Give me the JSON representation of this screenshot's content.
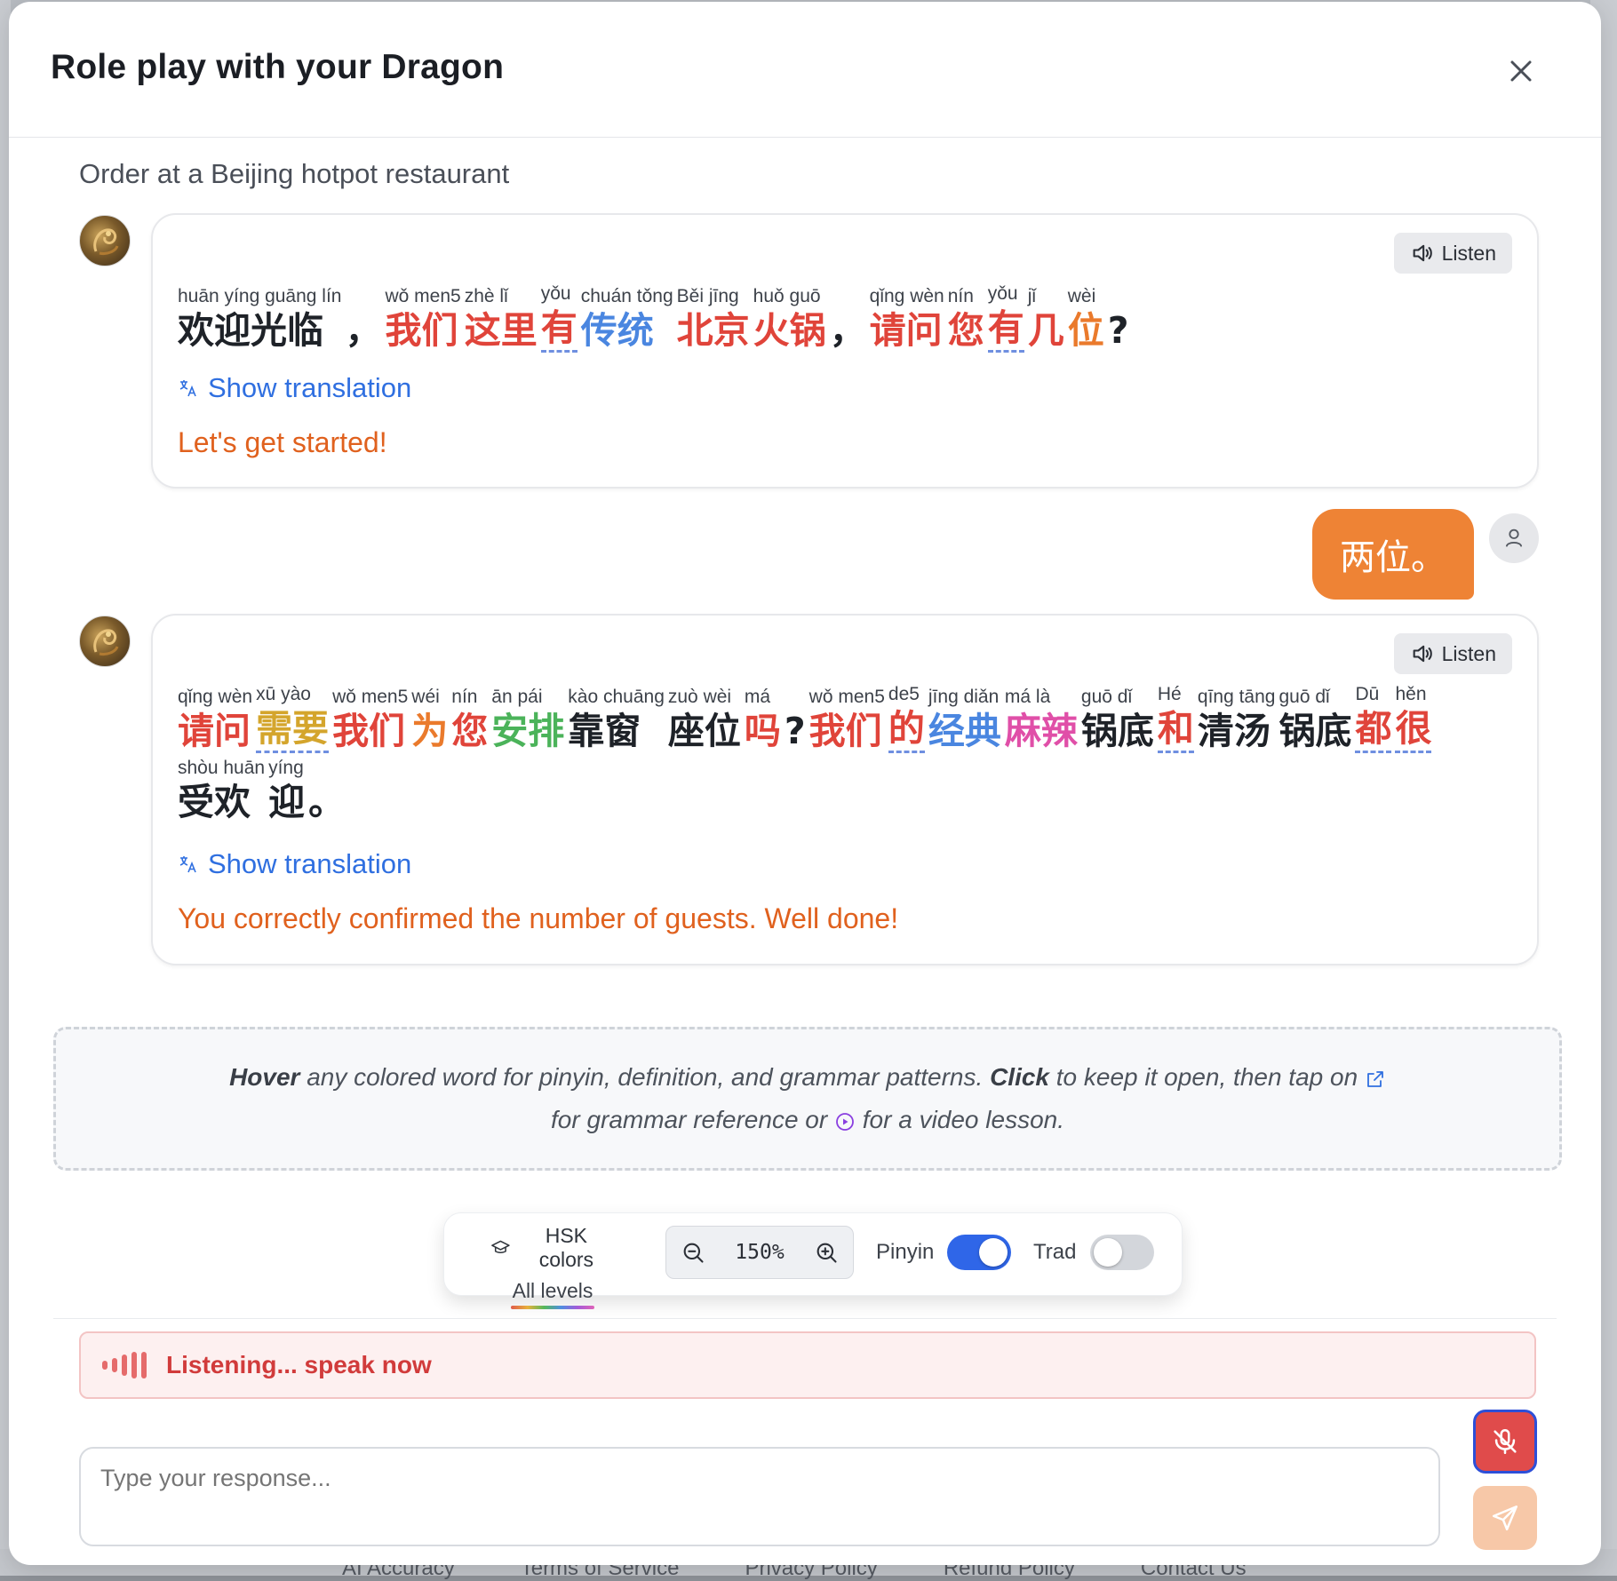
{
  "modal": {
    "title": "Role play with your Dragon",
    "scenario": "Order at a Beijing hotpot restaurant"
  },
  "messages": {
    "m1": {
      "listen_label": "Listen",
      "words": [
        {
          "py": "huān yíng guāng lín",
          "hz": "欢迎光临",
          "color": "#1e2228",
          "u": false
        },
        {
          "py": "",
          "hz": "，",
          "color": "#1e2228",
          "u": false
        },
        {
          "py": "wǒ men5",
          "hz": "我们",
          "color": "#e0443a",
          "u": false
        },
        {
          "py": "zhè lǐ",
          "hz": "这里",
          "color": "#e0443a",
          "u": false
        },
        {
          "py": "yǒu",
          "hz": "有",
          "color": "#e0443a",
          "u": true
        },
        {
          "py": "chuán tǒng",
          "hz": "传统",
          "color": "#4a86e0",
          "u": false
        },
        {
          "py": "Běi jīng",
          "hz": "北京",
          "color": "#e0443a",
          "u": false
        },
        {
          "py": "huǒ guō",
          "hz": "火锅",
          "color": "#e0443a",
          "u": false
        },
        {
          "py": "",
          "hz": "，",
          "color": "#1e2228",
          "u": false
        },
        {
          "py": "qǐng wèn",
          "hz": "请问",
          "color": "#e0443a",
          "u": false
        },
        {
          "py": "nín",
          "hz": "您",
          "color": "#e0443a",
          "u": false
        },
        {
          "py": "yǒu",
          "hz": "有",
          "color": "#e0443a",
          "u": true
        },
        {
          "py": "jǐ",
          "hz": "几",
          "color": "#e0443a",
          "u": false
        },
        {
          "py": "wèi",
          "hz": "位",
          "color": "#ea7a2c",
          "u": false
        },
        {
          "py": "",
          "hz": "?",
          "color": "#1e2228",
          "u": false
        }
      ],
      "show_translation": "Show translation",
      "feedback": "Let's get started!"
    },
    "user": {
      "text": "两位。"
    },
    "m2": {
      "listen_label": "Listen",
      "words": [
        {
          "py": "qǐng wèn",
          "hz": "请问",
          "color": "#e0443a",
          "u": false
        },
        {
          "py": "xū yào",
          "hz": "需要",
          "color": "#d4a52c",
          "u": true
        },
        {
          "py": "wǒ men5",
          "hz": "我们",
          "color": "#e0443a",
          "u": false
        },
        {
          "py": "wéi",
          "hz": "为",
          "color": "#ea7a2c",
          "u": false
        },
        {
          "py": "nín",
          "hz": "您",
          "color": "#e0443a",
          "u": false
        },
        {
          "py": "ān pái",
          "hz": "安排",
          "color": "#4bb35a",
          "u": false
        },
        {
          "py": "kào chuāng",
          "hz": "靠窗",
          "color": "#1e2228",
          "u": false
        },
        {
          "py": "zuò wèi",
          "hz": "座位",
          "color": "#1e2228",
          "u": false
        },
        {
          "py": "má",
          "hz": "吗",
          "color": "#e0443a",
          "u": false
        },
        {
          "py": "",
          "hz": "?",
          "color": "#1e2228",
          "u": false
        },
        {
          "py": "wǒ men5",
          "hz": "我们",
          "color": "#e0443a",
          "u": false
        },
        {
          "py": "de5",
          "hz": "的",
          "color": "#e0443a",
          "u": true
        },
        {
          "py": "jīng diǎn",
          "hz": "经典",
          "color": "#4a86e0",
          "u": false
        },
        {
          "py": "má là",
          "hz": "麻辣",
          "color": "#e04fa8",
          "u": false
        },
        {
          "py": "guō dǐ",
          "hz": "锅底",
          "color": "#1e2228",
          "u": false
        },
        {
          "py": "Hé",
          "hz": "和",
          "color": "#e0443a",
          "u": true
        },
        {
          "py": "qīng tāng",
          "hz": "清汤",
          "color": "#1e2228",
          "u": false
        },
        {
          "py": "guō dǐ",
          "hz": "锅底",
          "color": "#1e2228",
          "u": false
        },
        {
          "py": "Dū",
          "hz": "都",
          "color": "#e0443a",
          "u": true
        },
        {
          "py": "hěn",
          "hz": "很",
          "color": "#e0443a",
          "u": true
        },
        {
          "py": "shòu huān",
          "hz": "受欢",
          "color": "#1e2228",
          "u": false
        },
        {
          "py": "yíng",
          "hz": "迎",
          "color": "#1e2228",
          "u": false
        },
        {
          "py": "",
          "hz": "。",
          "color": "#1e2228",
          "u": false
        }
      ],
      "show_translation": "Show translation",
      "feedback": "You correctly confirmed the number of guests. Well done!"
    }
  },
  "hint": {
    "hover": "Hover",
    "text1": " any colored word for pinyin, definition, and grammar patterns. ",
    "click": "Click",
    "text2": " to keep it open, then tap on ",
    "text3": "for grammar reference or ",
    "text4": " for a video lesson."
  },
  "toolbar": {
    "hsk_label": "HSK colors",
    "hsk_levels": "All levels",
    "zoom_value": "150%",
    "pinyin_label": "Pinyin",
    "pinyin_on": true,
    "trad_label": "Trad",
    "trad_on": false,
    "accent": "#2f66e8"
  },
  "listening": {
    "text": "Listening... speak now"
  },
  "input": {
    "placeholder": "Type your response..."
  },
  "background_footer": [
    "AI Accuracy",
    "Terms of Service",
    "Privacy Policy",
    "Refund Policy",
    "Contact Us"
  ],
  "colors": {
    "brand": "#ee8335",
    "link": "#2f6fe0",
    "feedback": "#e0611e",
    "mic": "#e04b4b"
  }
}
